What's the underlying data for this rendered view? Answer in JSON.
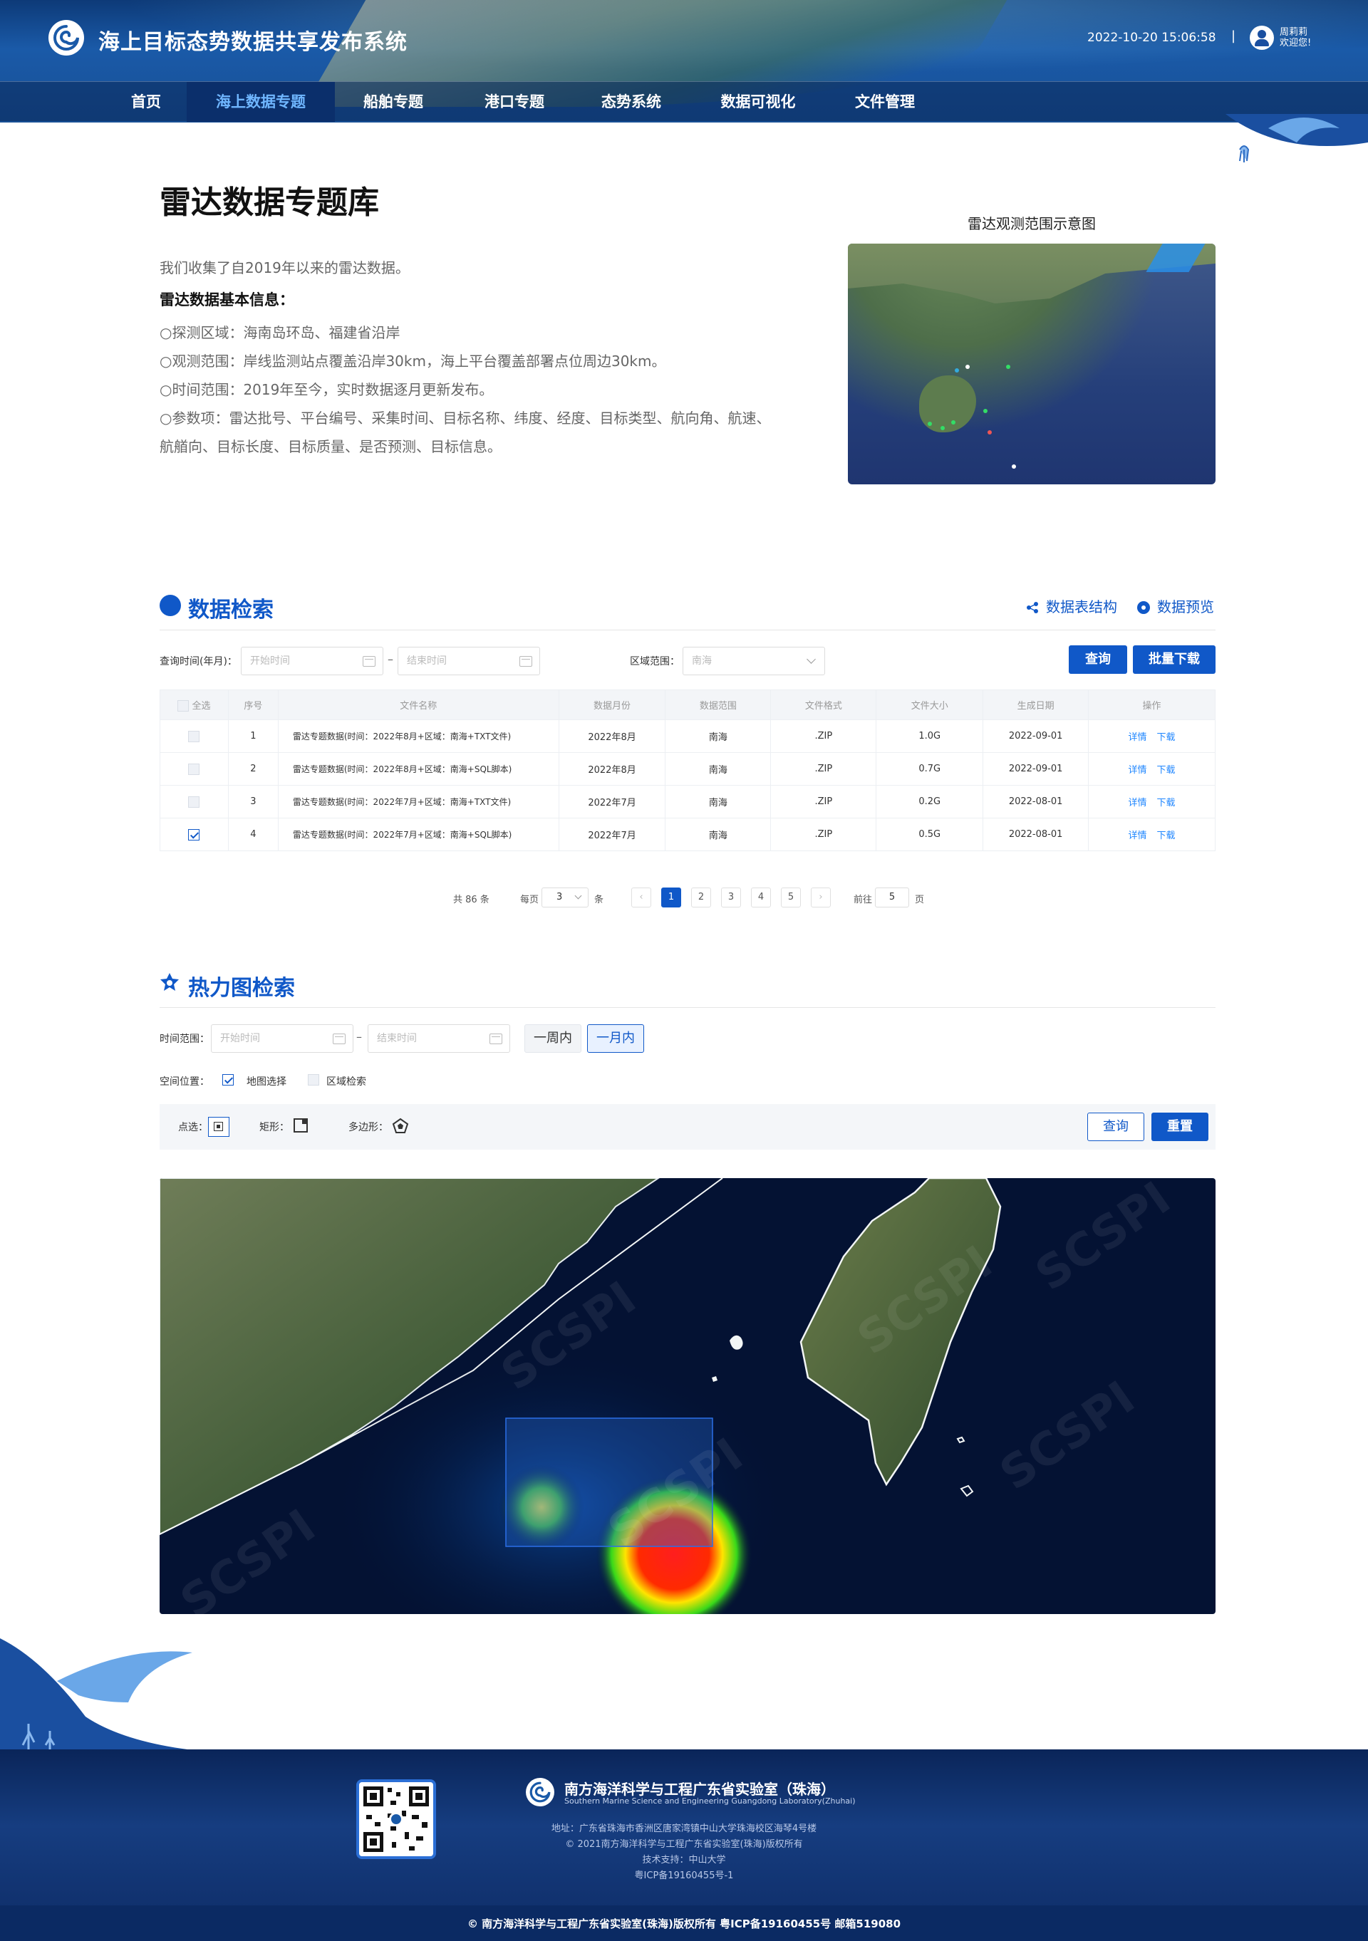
{
  "header": {
    "title": "海上目标态势数据共享发布系统",
    "datetime": "2022-10-20 15:06:58",
    "separator": "|",
    "user_name": "周莉莉",
    "welcome": "欢迎您!"
  },
  "nav": [
    "首页",
    "海上数据专题",
    "船舶专题",
    "港口专题",
    "态势系统",
    "数据可视化",
    "文件管理"
  ],
  "nav_active": 1,
  "intro": {
    "title": "雷达数据专题库",
    "desc": "我们收集了自2019年以来的雷达数据。",
    "info_title": "雷达数据基本信息：",
    "items": [
      "○探测区域：海南岛环岛、福建省沿岸",
      "○观测范围：岸线监测站点覆盖沿岸30km，海上平台覆盖部署点位周边30km。",
      "○时间范围：2019年至今，实时数据逐月更新发布。",
      "○参数项：雷达批号、平台编号、采集时间、目标名称、纬度、经度、目标类型、航向角、航速、",
      "航艏向、目标长度、目标质量、是否预测、目标信息。"
    ],
    "map_title": "雷达观测范围示意图"
  },
  "search": {
    "title": "数据检索",
    "schema_link": "数据表结构",
    "preview_link": "数据预览",
    "time_label": "查询时间(年月)：",
    "start_placeholder": "开始时间",
    "end_placeholder": "结束时间",
    "dash": "–",
    "area_label": "区域范围：",
    "area_value": "南海",
    "query_btn": "查询",
    "batch_btn": "批量下载"
  },
  "table": {
    "headers": [
      "全选",
      "序号",
      "文件名称",
      "数据月份",
      "数据范围",
      "文件格式",
      "文件大小",
      "生成日期",
      "操作"
    ],
    "rows": [
      {
        "no": "1",
        "name": "雷达专题数据(时间：2022年8月+区域：南海+TXT文件)",
        "month": "2022年8月",
        "range": "南海",
        "fmt": ".ZIP",
        "size": "1.0G",
        "date": "2022-09-01",
        "op1": "详情",
        "op2": "下载",
        "checked": false
      },
      {
        "no": "2",
        "name": "雷达专题数据(时间：2022年8月+区域：南海+SQL脚本)",
        "month": "2022年8月",
        "range": "南海",
        "fmt": ".ZIP",
        "size": "0.7G",
        "date": "2022-09-01",
        "op1": "详情",
        "op2": "下载",
        "checked": false
      },
      {
        "no": "3",
        "name": "雷达专题数据(时间：2022年7月+区域：南海+TXT文件)",
        "month": "2022年7月",
        "range": "南海",
        "fmt": ".ZIP",
        "size": "0.2G",
        "date": "2022-08-01",
        "op1": "详情",
        "op2": "下载",
        "checked": false
      },
      {
        "no": "4",
        "name": "雷达专题数据(时间：2022年7月+区域：南海+SQL脚本)",
        "month": "2022年7月",
        "range": "南海",
        "fmt": ".ZIP",
        "size": "0.5G",
        "date": "2022-08-01",
        "op1": "详情",
        "op2": "下载",
        "checked": true
      }
    ]
  },
  "pagination": {
    "total": "共 86 条",
    "per_page_label": "每页",
    "per_page": "3",
    "per_page_unit": "条",
    "pages": [
      "1",
      "2",
      "3",
      "4",
      "5"
    ],
    "current": "1",
    "goto_label": "前往",
    "goto_value": "5",
    "goto_unit": "页"
  },
  "heatmap": {
    "title": "热力图检索",
    "time_label": "时间范围：",
    "start_placeholder": "开始时间",
    "end_placeholder": "结束时间",
    "week_btn": "一周内",
    "month_btn": "一月内",
    "space_label": "空间位置：",
    "map_select": "地图选择",
    "area_search": "区域检索",
    "point_label": "点选：",
    "rect_label": "矩形：",
    "poly_label": "多边形：",
    "query_btn": "查询",
    "reset_btn": "重置",
    "watermark": "SCSPI"
  },
  "footer": {
    "org": "南方海洋科学与工程广东省实验室（珠海）",
    "org_en": "Southern Marine Science and Engineering Guangdong Laboratory(Zhuhai)",
    "address": "地址：广东省珠海市香洲区唐家湾镇中山大学珠海校区海琴4号楼",
    "copyright": "© 2021南方海洋科学与工程广东省实验室(珠海)版权所有",
    "support": "技术支持：中山大学",
    "icp": "粤ICP备19160455号-1",
    "bottom": "© 南方海洋科学与工程广东省实验室(珠海)版权所有   粤ICP备19160455号   邮箱519080"
  },
  "colors": {
    "primary": "#1058c8",
    "link": "#1f86ff",
    "header_bg": "#184f95",
    "footer_bg": "#0e2c66"
  }
}
